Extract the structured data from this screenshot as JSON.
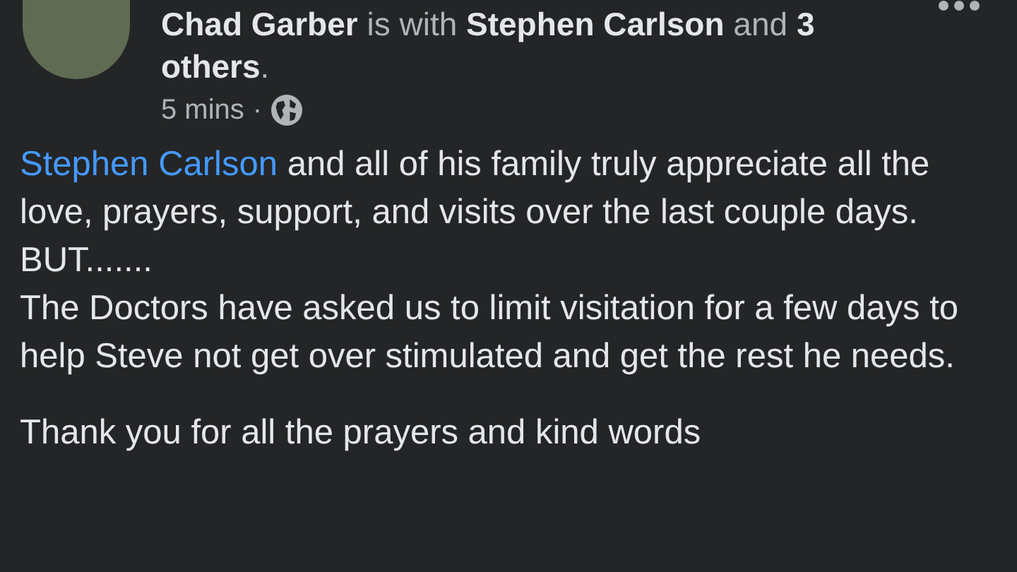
{
  "post": {
    "header": "**Chad Garber** is with **Stephen Carlson** and **3 others**.",
    "time": "5 mins",
    "separator": "·",
    "body": [
      {
        "mention": "Stephen Carlson",
        "text": "and all of his family truly appreciate all the love, prayers, support, and visits over the last couple days."
      },
      {
        "text": "BUT......."
      },
      {
        "text": "The Doctors have asked us to limit visitation for a few days to help Steve not get over stimulated and get the rest he needs."
      }
    ],
    "closing": "Thank you for all the prayers and kind words"
  }
}
